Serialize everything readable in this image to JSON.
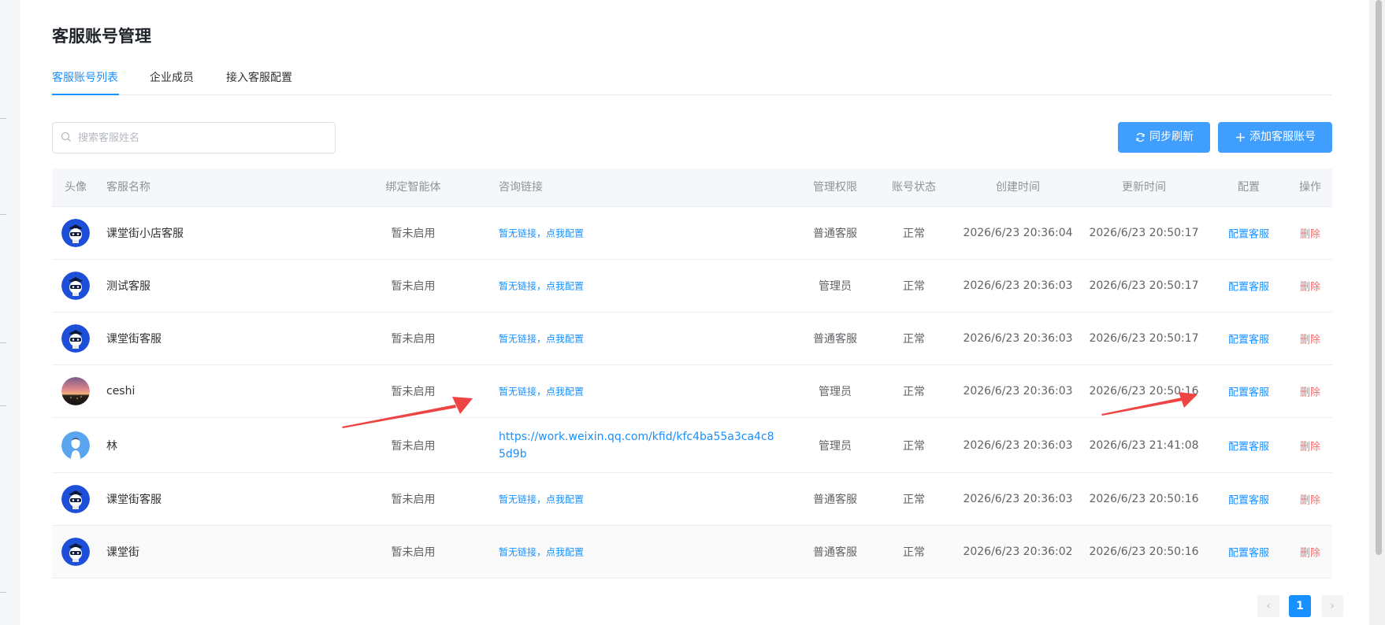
{
  "page": {
    "title": "客服账号管理"
  },
  "tabs": [
    "客服账号列表",
    "企业成员",
    "接入客服配置"
  ],
  "search": {
    "placeholder": "搜索客服姓名",
    "value": ""
  },
  "toolbar": {
    "sync_label": "同步刷新",
    "add_label": "添加客服账号"
  },
  "table": {
    "headers": {
      "avatar": "头像",
      "name": "客服名称",
      "bind": "绑定智能体",
      "link": "咨询链接",
      "perm": "管理权限",
      "status": "账号状态",
      "created": "创建时间",
      "updated": "更新时间",
      "config": "配置",
      "action": "操作"
    },
    "rows": [
      {
        "avatar": "robot-avatar",
        "name": "课堂街小店客服",
        "bind": "暂未启用",
        "link": "暂无链接，点我配置",
        "perm": "普通客服",
        "status": "正常",
        "created": "2026/6/23 20:36:04",
        "updated": "2026/6/23 20:50:17",
        "config": "配置客服",
        "action": "删除"
      },
      {
        "avatar": "robot-avatar",
        "name": "测试客服",
        "bind": "暂未启用",
        "link": "暂无链接，点我配置",
        "perm": "管理员",
        "status": "正常",
        "created": "2026/6/23 20:36:03",
        "updated": "2026/6/23 20:50:17",
        "config": "配置客服",
        "action": "删除"
      },
      {
        "avatar": "robot-avatar",
        "name": "课堂街客服",
        "bind": "暂未启用",
        "link": "暂无链接，点我配置",
        "perm": "普通客服",
        "status": "正常",
        "created": "2026/6/23 20:36:03",
        "updated": "2026/6/23 20:50:17",
        "config": "配置客服",
        "action": "删除"
      },
      {
        "avatar": "sunset-photo-avatar",
        "name": "ceshi",
        "bind": "暂未启用",
        "link": "暂无链接，点我配置",
        "perm": "管理员",
        "status": "正常",
        "created": "2026/6/23 20:36:03",
        "updated": "2026/6/23 20:50:16",
        "config": "配置客服",
        "action": "删除"
      },
      {
        "avatar": "default-person-avatar",
        "name": "林",
        "bind": "暂未启用",
        "link": "https://work.weixin.qq.com/kfid/kfc4ba55a3ca4c85d9b",
        "perm": "管理员",
        "status": "正常",
        "created": "2026/6/23 20:36:03",
        "updated": "2026/6/23 21:41:08",
        "config": "配置客服",
        "action": "删除"
      },
      {
        "avatar": "robot-avatar",
        "name": "课堂街客服",
        "bind": "暂未启用",
        "link": "暂无链接，点我配置",
        "perm": "普通客服",
        "status": "正常",
        "created": "2026/6/23 20:36:03",
        "updated": "2026/6/23 20:50:16",
        "config": "配置客服",
        "action": "删除"
      },
      {
        "avatar": "robot-avatar",
        "name": "课堂街",
        "bind": "暂未启用",
        "link": "暂无链接，点我配置",
        "perm": "普通客服",
        "status": "正常",
        "created": "2026/6/23 20:36:02",
        "updated": "2026/6/23 20:50:16",
        "config": "配置客服",
        "action": "删除"
      }
    ]
  },
  "pagination": {
    "prev": "‹",
    "current": "1",
    "next": "›"
  },
  "colors": {
    "primary": "#1890ff",
    "button": "#409eff",
    "danger": "#f56c6c",
    "annotation_arrow": "#ef4444"
  }
}
